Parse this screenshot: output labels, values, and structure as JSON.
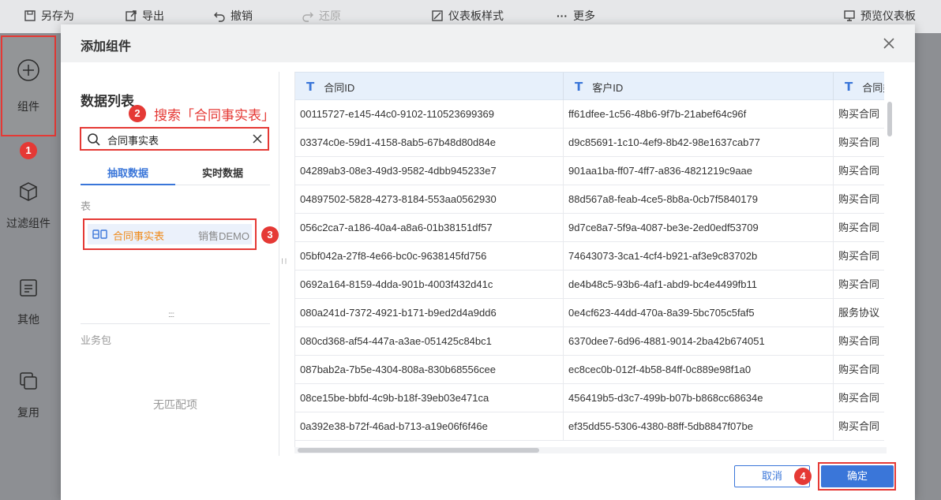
{
  "toolbar": {
    "save_as": "另存为",
    "export": "导出",
    "undo": "撤销",
    "redo": "还原",
    "dashboard_style": "仪表板样式",
    "more": "更多",
    "preview": "预览仪表板"
  },
  "sidebar": {
    "items": [
      {
        "label": "组件",
        "icon": "plus-circle-icon"
      },
      {
        "label": "过滤组件",
        "icon": "cube-icon"
      },
      {
        "label": "其他",
        "icon": "document-icon"
      },
      {
        "label": "复用",
        "icon": "copy-icon"
      }
    ]
  },
  "dialog": {
    "title": "添加组件",
    "data_list_title": "数据列表",
    "search": {
      "value": "合同事实表"
    },
    "tabs": [
      "抽取数据",
      "实时数据"
    ],
    "active_tab": 0,
    "section_table": "表",
    "table_item": {
      "name": "合同事实表",
      "source": "销售DEMO",
      "icon": "db-table-icon"
    },
    "section_package": "业务包",
    "no_match": "无匹配项",
    "columns": [
      "合同ID",
      "客户ID",
      "合同类型"
    ],
    "rows": [
      [
        "00115727-e145-44c0-9102-110523699369",
        "ff61dfee-1c56-48b6-9f7b-21abef64c96f",
        "购买合同"
      ],
      [
        "03374c0e-59d1-4158-8ab5-67b48d80d84e",
        "d9c85691-1c10-4ef9-8b42-98e1637cab77",
        "购买合同"
      ],
      [
        "04289ab3-08e3-49d3-9582-4dbb945233e7",
        "901aa1ba-ff07-4ff7-a836-4821219c9aae",
        "购买合同"
      ],
      [
        "04897502-5828-4273-8184-553aa0562930",
        "88d567a8-feab-4ce5-8b8a-0cb7f5840179",
        "购买合同"
      ],
      [
        "056c2ca7-a186-40a4-a8a6-01b38151df57",
        "9d7ce8a7-5f9a-4087-be3e-2ed0edf53709",
        "购买合同"
      ],
      [
        "05bf042a-27f8-4e66-bc0c-9638145fd756",
        "74643073-3ca1-4cf4-b921-af3e9c83702b",
        "购买合同"
      ],
      [
        "0692a164-8159-4dda-901b-4003f432d41c",
        "de4b48c5-93b6-4af1-abd9-bc4e4499fb11",
        "购买合同"
      ],
      [
        "080a241d-7372-4921-b171-b9ed2d4a9dd6",
        "0e4cf623-44dd-470a-8a39-5bc705c5faf5",
        "服务协议"
      ],
      [
        "080cd368-af54-447a-a3ae-051425c84bc1",
        "6370dee7-6d96-4881-9014-2ba42b674051",
        "购买合同"
      ],
      [
        "087bab2a-7b5e-4304-808a-830b68556cee",
        "ec8cec0b-012f-4b58-84ff-0c889e98f1a0",
        "购买合同"
      ],
      [
        "08ce15be-bbfd-4c9b-b18f-39eb03e471ca",
        "456419b5-d3c7-499b-b07b-b868cc68634e",
        "购买合同"
      ],
      [
        "0a392e38-b72f-46ad-b713-a19e06f6f46e",
        "ef35dd55-5306-4380-88ff-5db8847f07be",
        "购买合同"
      ]
    ],
    "cancel": "取消",
    "confirm": "确定"
  },
  "annotations": {
    "step1": "1",
    "step2": "2",
    "step2_text": "搜索「合同事实表」",
    "step3": "3",
    "step4": "4"
  },
  "colors": {
    "accent": "#3a76d9",
    "annotation": "#e53935",
    "table_name": "#ef8a1a"
  }
}
